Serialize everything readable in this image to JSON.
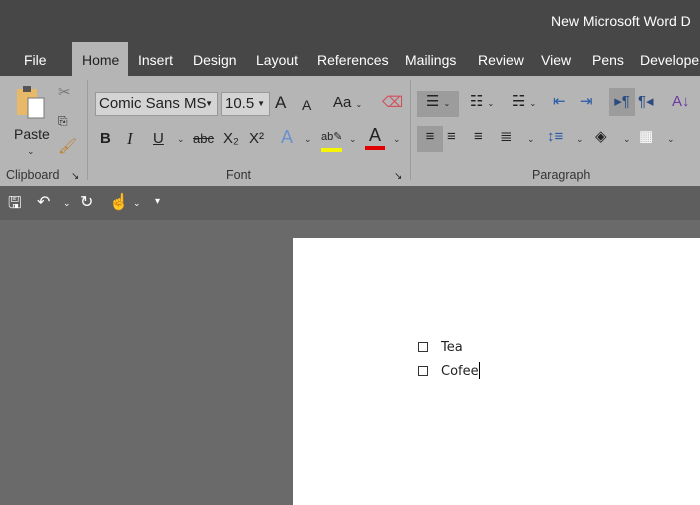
{
  "title": "New Microsoft Word D",
  "tabs": [
    "File",
    "Home",
    "Insert",
    "Design",
    "Layout",
    "References",
    "Mailings",
    "Review",
    "View",
    "Pens",
    "Developer"
  ],
  "clipboard": {
    "paste": "Paste",
    "group": "Clipboard"
  },
  "font": {
    "name": "Comic Sans MS",
    "size": "10.5",
    "group": "Font",
    "case_label": "Aa",
    "bold": "B",
    "italic": "I",
    "underline": "U",
    "strike": "abc",
    "sub": "X₂",
    "sup": "X²"
  },
  "paragraph": {
    "group": "Paragraph"
  },
  "colors": {
    "highlight": "#f5f500",
    "font_color": "#e00000"
  },
  "document": {
    "items": [
      "Tea",
      "Cofee"
    ]
  }
}
